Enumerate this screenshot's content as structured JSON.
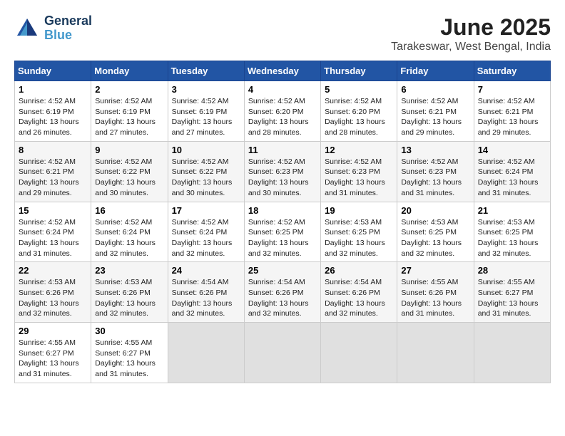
{
  "header": {
    "logo_line1": "General",
    "logo_line2": "Blue",
    "title": "June 2025",
    "subtitle": "Tarakeswar, West Bengal, India"
  },
  "calendar": {
    "headers": [
      "Sunday",
      "Monday",
      "Tuesday",
      "Wednesday",
      "Thursday",
      "Friday",
      "Saturday"
    ],
    "weeks": [
      [
        null,
        {
          "day": "2",
          "sunrise": "4:52 AM",
          "sunset": "6:19 PM",
          "daylight": "13 hours and 27 minutes."
        },
        {
          "day": "3",
          "sunrise": "4:52 AM",
          "sunset": "6:19 PM",
          "daylight": "13 hours and 27 minutes."
        },
        {
          "day": "4",
          "sunrise": "4:52 AM",
          "sunset": "6:20 PM",
          "daylight": "13 hours and 28 minutes."
        },
        {
          "day": "5",
          "sunrise": "4:52 AM",
          "sunset": "6:20 PM",
          "daylight": "13 hours and 28 minutes."
        },
        {
          "day": "6",
          "sunrise": "4:52 AM",
          "sunset": "6:21 PM",
          "daylight": "13 hours and 29 minutes."
        },
        {
          "day": "7",
          "sunrise": "4:52 AM",
          "sunset": "6:21 PM",
          "daylight": "13 hours and 29 minutes."
        }
      ],
      [
        {
          "day": "1",
          "sunrise": "4:52 AM",
          "sunset": "6:19 PM",
          "daylight": "13 hours and 26 minutes."
        },
        {
          "day": "9",
          "sunrise": "4:52 AM",
          "sunset": "6:22 PM",
          "daylight": "13 hours and 30 minutes."
        },
        {
          "day": "10",
          "sunrise": "4:52 AM",
          "sunset": "6:22 PM",
          "daylight": "13 hours and 30 minutes."
        },
        {
          "day": "11",
          "sunrise": "4:52 AM",
          "sunset": "6:23 PM",
          "daylight": "13 hours and 30 minutes."
        },
        {
          "day": "12",
          "sunrise": "4:52 AM",
          "sunset": "6:23 PM",
          "daylight": "13 hours and 31 minutes."
        },
        {
          "day": "13",
          "sunrise": "4:52 AM",
          "sunset": "6:23 PM",
          "daylight": "13 hours and 31 minutes."
        },
        {
          "day": "14",
          "sunrise": "4:52 AM",
          "sunset": "6:24 PM",
          "daylight": "13 hours and 31 minutes."
        }
      ],
      [
        {
          "day": "8",
          "sunrise": "4:52 AM",
          "sunset": "6:21 PM",
          "daylight": "13 hours and 29 minutes."
        },
        {
          "day": "16",
          "sunrise": "4:52 AM",
          "sunset": "6:24 PM",
          "daylight": "13 hours and 32 minutes."
        },
        {
          "day": "17",
          "sunrise": "4:52 AM",
          "sunset": "6:24 PM",
          "daylight": "13 hours and 32 minutes."
        },
        {
          "day": "18",
          "sunrise": "4:52 AM",
          "sunset": "6:25 PM",
          "daylight": "13 hours and 32 minutes."
        },
        {
          "day": "19",
          "sunrise": "4:53 AM",
          "sunset": "6:25 PM",
          "daylight": "13 hours and 32 minutes."
        },
        {
          "day": "20",
          "sunrise": "4:53 AM",
          "sunset": "6:25 PM",
          "daylight": "13 hours and 32 minutes."
        },
        {
          "day": "21",
          "sunrise": "4:53 AM",
          "sunset": "6:25 PM",
          "daylight": "13 hours and 32 minutes."
        }
      ],
      [
        {
          "day": "15",
          "sunrise": "4:52 AM",
          "sunset": "6:24 PM",
          "daylight": "13 hours and 31 minutes."
        },
        {
          "day": "23",
          "sunrise": "4:53 AM",
          "sunset": "6:26 PM",
          "daylight": "13 hours and 32 minutes."
        },
        {
          "day": "24",
          "sunrise": "4:54 AM",
          "sunset": "6:26 PM",
          "daylight": "13 hours and 32 minutes."
        },
        {
          "day": "25",
          "sunrise": "4:54 AM",
          "sunset": "6:26 PM",
          "daylight": "13 hours and 32 minutes."
        },
        {
          "day": "26",
          "sunrise": "4:54 AM",
          "sunset": "6:26 PM",
          "daylight": "13 hours and 32 minutes."
        },
        {
          "day": "27",
          "sunrise": "4:55 AM",
          "sunset": "6:26 PM",
          "daylight": "13 hours and 31 minutes."
        },
        {
          "day": "28",
          "sunrise": "4:55 AM",
          "sunset": "6:27 PM",
          "daylight": "13 hours and 31 minutes."
        }
      ],
      [
        {
          "day": "22",
          "sunrise": "4:53 AM",
          "sunset": "6:26 PM",
          "daylight": "13 hours and 32 minutes."
        },
        {
          "day": "30",
          "sunrise": "4:55 AM",
          "sunset": "6:27 PM",
          "daylight": "13 hours and 31 minutes."
        },
        null,
        null,
        null,
        null,
        null
      ],
      [
        {
          "day": "29",
          "sunrise": "4:55 AM",
          "sunset": "6:27 PM",
          "daylight": "13 hours and 31 minutes."
        },
        null,
        null,
        null,
        null,
        null,
        null
      ]
    ]
  }
}
